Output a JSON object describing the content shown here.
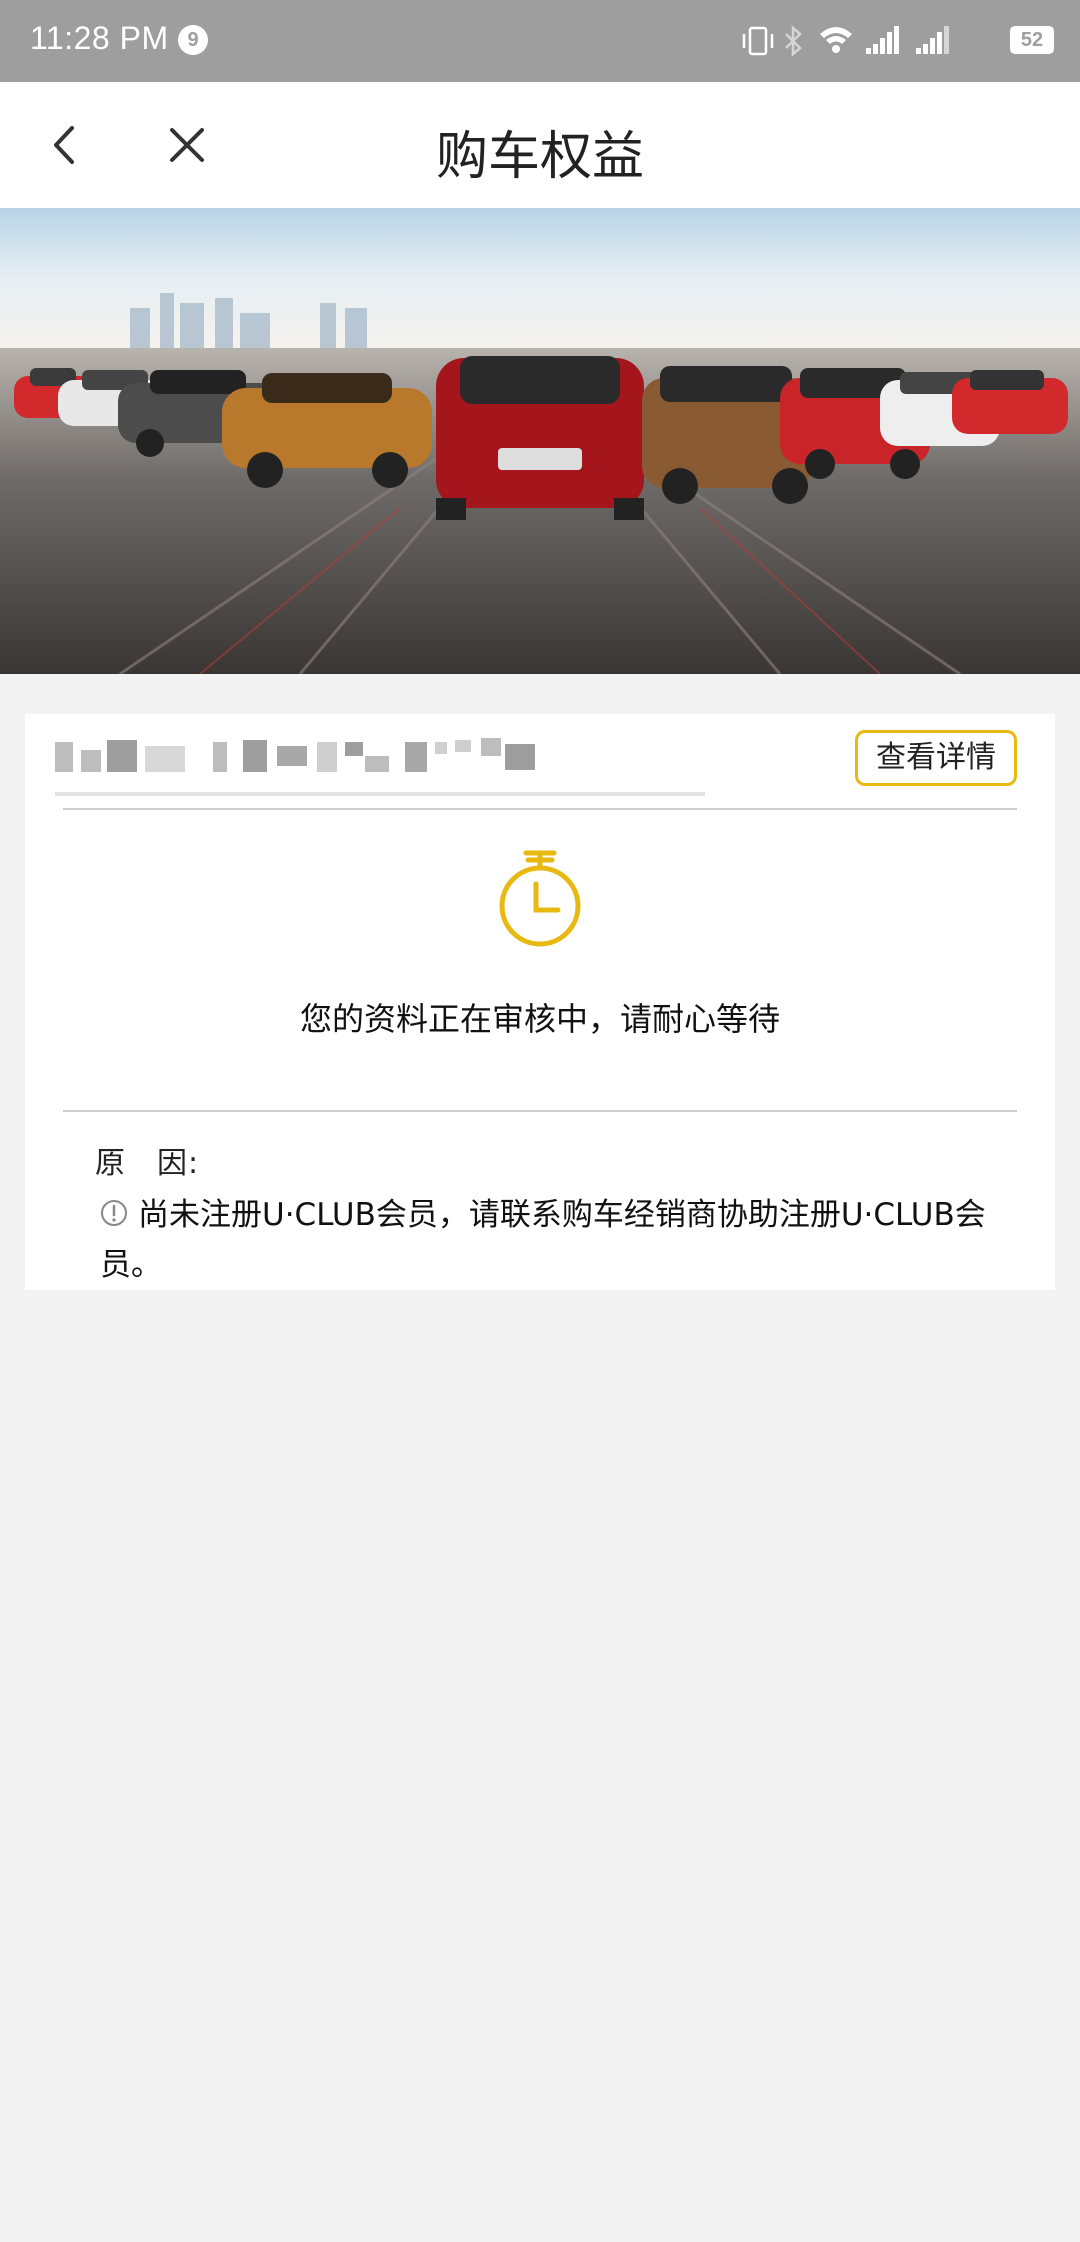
{
  "status_bar": {
    "time": "11:28 PM",
    "notification_count": "9",
    "battery": "52"
  },
  "nav": {
    "title": "购车权益"
  },
  "card": {
    "detail_button": "查看详情",
    "status_message": "您的资料正在审核中，请耐心等待",
    "reason_label": "原　因:",
    "reason_text": "尚未注册U·CLUB会员，请联系购车经销商协助注册U·CLUB会员。"
  },
  "colors": {
    "accent": "#e8b911",
    "background": "#f3f3f3",
    "status_bar": "#9e9e9e"
  },
  "icons": [
    "back-arrow-icon",
    "close-icon",
    "stopwatch-icon",
    "alert-circle-icon",
    "vibrate-icon",
    "bluetooth-icon",
    "wifi-icon",
    "signal-icon",
    "battery-icon"
  ]
}
